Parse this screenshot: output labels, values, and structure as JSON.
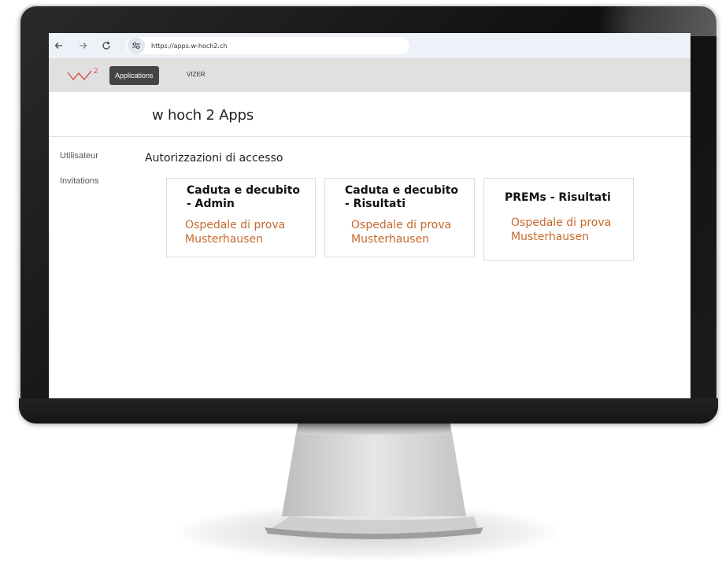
{
  "browser": {
    "url": "https://apps.w-hoch2.ch"
  },
  "app_nav": {
    "logo_label": "2",
    "applications_label": "Applications",
    "vizer_label": "VIZER"
  },
  "page": {
    "title": "w hoch 2 Apps",
    "section_title": "Autorizzazioni di accesso"
  },
  "side_menu": {
    "items": [
      {
        "label": "Utilisateur"
      },
      {
        "label": "Invitations"
      }
    ]
  },
  "cards": [
    {
      "title_line1": "Caduta e decubito",
      "title_line2": "- Admin",
      "sub_line1": "Ospedale di prova",
      "sub_line2": "Musterhausen"
    },
    {
      "title_line1": "Caduta e decubito",
      "title_line2": "- Risultati",
      "sub_line1": "Ospedale di prova",
      "sub_line2": "Musterhausen"
    },
    {
      "title_line1": "PREMs - Risultati",
      "sub_line1": "Ospedale di prova",
      "sub_line2": "Musterhausen"
    }
  ],
  "colors": {
    "accent": "#c56a2c",
    "logo": "#d9534f",
    "nav_button": "#444444"
  },
  "icons": {
    "back": "arrow-left-icon",
    "forward": "arrow-right-icon",
    "reload": "reload-icon",
    "site_settings": "tune-icon"
  }
}
